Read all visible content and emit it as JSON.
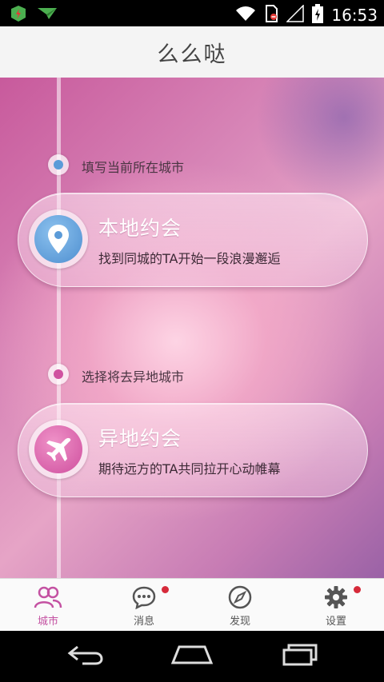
{
  "status_bar": {
    "time": "16:53",
    "left_icons": [
      "app-notification-icon",
      "message-notification-icon"
    ],
    "right_icons": [
      "wifi-icon",
      "no-sim-icon",
      "signal-icon",
      "battery-charging-icon"
    ]
  },
  "header": {
    "title": "么么哒"
  },
  "main": {
    "step1": {
      "label": "填写当前所在城市",
      "dot_color": "#5b9bd8"
    },
    "card1": {
      "title": "本地约会",
      "subtitle": "找到同城的TA开始一段浪漫邂逅",
      "icon": "location-pin-icon",
      "icon_color": "#4e8fd0"
    },
    "step2": {
      "label": "选择将去异地城市",
      "dot_color": "#d052a0"
    },
    "card2": {
      "title": "异地约会",
      "subtitle": "期待远方的TA共同拉开心动帷幕",
      "icon": "airplane-icon",
      "icon_color": "#cf4f9e"
    }
  },
  "tab_bar": {
    "tabs": [
      {
        "label": "城市",
        "icon": "people-icon",
        "active": true,
        "badge": false
      },
      {
        "label": "消息",
        "icon": "chat-icon",
        "active": false,
        "badge": true
      },
      {
        "label": "发现",
        "icon": "compass-icon",
        "active": false,
        "badge": false
      },
      {
        "label": "设置",
        "icon": "gear-icon",
        "active": false,
        "badge": true
      }
    ],
    "active_color": "#c452a2",
    "badge_color": "#d62a3a"
  },
  "nav_bar": {
    "buttons": [
      "back-icon",
      "home-icon",
      "recent-apps-icon"
    ]
  }
}
